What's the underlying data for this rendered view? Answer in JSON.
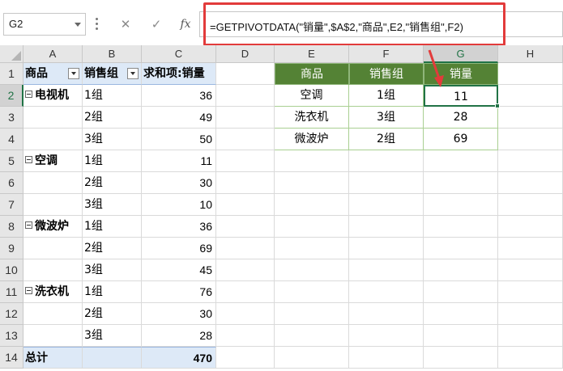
{
  "formula_bar": {
    "name_box": "G2",
    "cancel_icon": "✕",
    "enter_icon": "✓",
    "fx_label": "fx",
    "formula": "=GETPIVOTDATA(\"销量\",$A$2,\"商品\",E2,\"销售组\",F2)"
  },
  "columns": [
    "A",
    "B",
    "C",
    "D",
    "E",
    "F",
    "G",
    "H"
  ],
  "rows": [
    "1",
    "2",
    "3",
    "4",
    "5",
    "6",
    "7",
    "8",
    "9",
    "10",
    "11",
    "12",
    "13",
    "14"
  ],
  "pivot": {
    "headers": [
      "商品",
      "销售组",
      "求和项:销量"
    ],
    "groups": [
      {
        "name": "电视机",
        "rows": [
          {
            "group": "1组",
            "value": "36"
          },
          {
            "group": "2组",
            "value": "49"
          },
          {
            "group": "3组",
            "value": "50"
          }
        ]
      },
      {
        "name": "空调",
        "rows": [
          {
            "group": "1组",
            "value": "11"
          },
          {
            "group": "2组",
            "value": "30"
          },
          {
            "group": "3组",
            "value": "10"
          }
        ]
      },
      {
        "name": "微波炉",
        "rows": [
          {
            "group": "1组",
            "value": "36"
          },
          {
            "group": "2组",
            "value": "69"
          },
          {
            "group": "3组",
            "value": "45"
          }
        ]
      },
      {
        "name": "洗衣机",
        "rows": [
          {
            "group": "1组",
            "value": "76"
          },
          {
            "group": "2组",
            "value": "30"
          },
          {
            "group": "3组",
            "value": "28"
          }
        ]
      }
    ],
    "total_label": "总计",
    "total_value": "470"
  },
  "lookup": {
    "headers": [
      "商品",
      "销售组",
      "销量"
    ],
    "rows": [
      [
        "空调",
        "1组",
        "11"
      ],
      [
        "洗衣机",
        "3组",
        "28"
      ],
      [
        "微波炉",
        "2组",
        "69"
      ]
    ]
  },
  "colors": {
    "pivot_header_fill": "#dde9f7",
    "lookup_header_fill": "#548235",
    "selection_green": "#217346",
    "highlight_red": "#e23b3b"
  }
}
